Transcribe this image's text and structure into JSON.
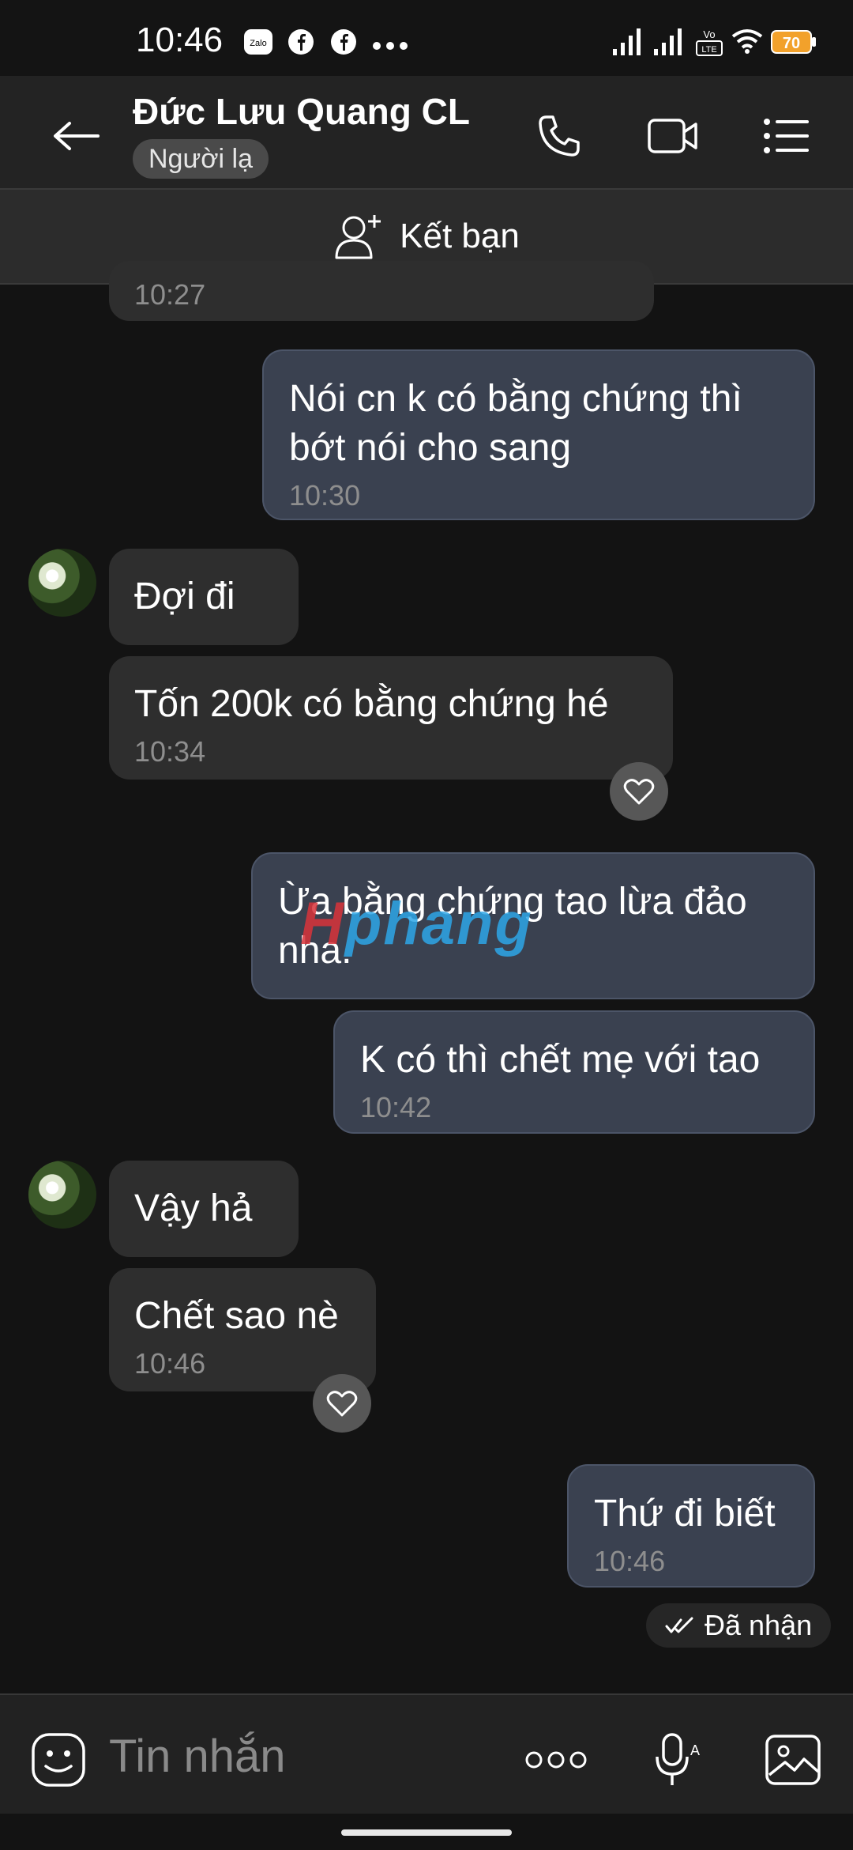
{
  "status_bar": {
    "time": "10:46",
    "battery": "70",
    "network": "LTE",
    "icons": [
      "zalo-icon",
      "facebook-icon",
      "facebook-icon",
      "more-dots-icon",
      "signal-icon",
      "signal-icon",
      "volte-icon",
      "wifi-icon",
      "battery-icon"
    ]
  },
  "header": {
    "contact_name": "Đức Lưu Quang CL",
    "badge": "Người lạ",
    "icons": [
      "back-arrow-icon",
      "phone-icon",
      "video-call-icon",
      "menu-list-icon"
    ]
  },
  "friend_bar": {
    "label": "Kết bạn",
    "icon": "add-friend-icon"
  },
  "messages": [
    {
      "side": "received",
      "text": "",
      "time": "10:27"
    },
    {
      "side": "sent",
      "text": "Nói cn k có bằng chứng thì bớt nói cho sang",
      "time": "10:30"
    },
    {
      "side": "received",
      "text": "Đợi đi",
      "time": ""
    },
    {
      "side": "received",
      "text": "Tốn 200k có bằng chứng hé",
      "time": "10:34"
    },
    {
      "side": "sent",
      "text": "Ừa bằng chứng tao lừa đảo nha.",
      "time": ""
    },
    {
      "side": "sent",
      "text": "K có thì chết mẹ với tao",
      "time": "10:42"
    },
    {
      "side": "received",
      "text": "Vậy hả",
      "time": ""
    },
    {
      "side": "received",
      "text": "Chết sao nè",
      "time": "10:46"
    },
    {
      "side": "sent",
      "text": "Thứ đi biết",
      "time": "10:46"
    }
  ],
  "received_status": "Đã nhận",
  "watermark": {
    "prefix": "H",
    "rest": "phang"
  },
  "input_bar": {
    "placeholder": "Tin nhắn",
    "icons": [
      "sticker-icon",
      "more-options-icon",
      "voice-icon",
      "image-icon"
    ]
  }
}
